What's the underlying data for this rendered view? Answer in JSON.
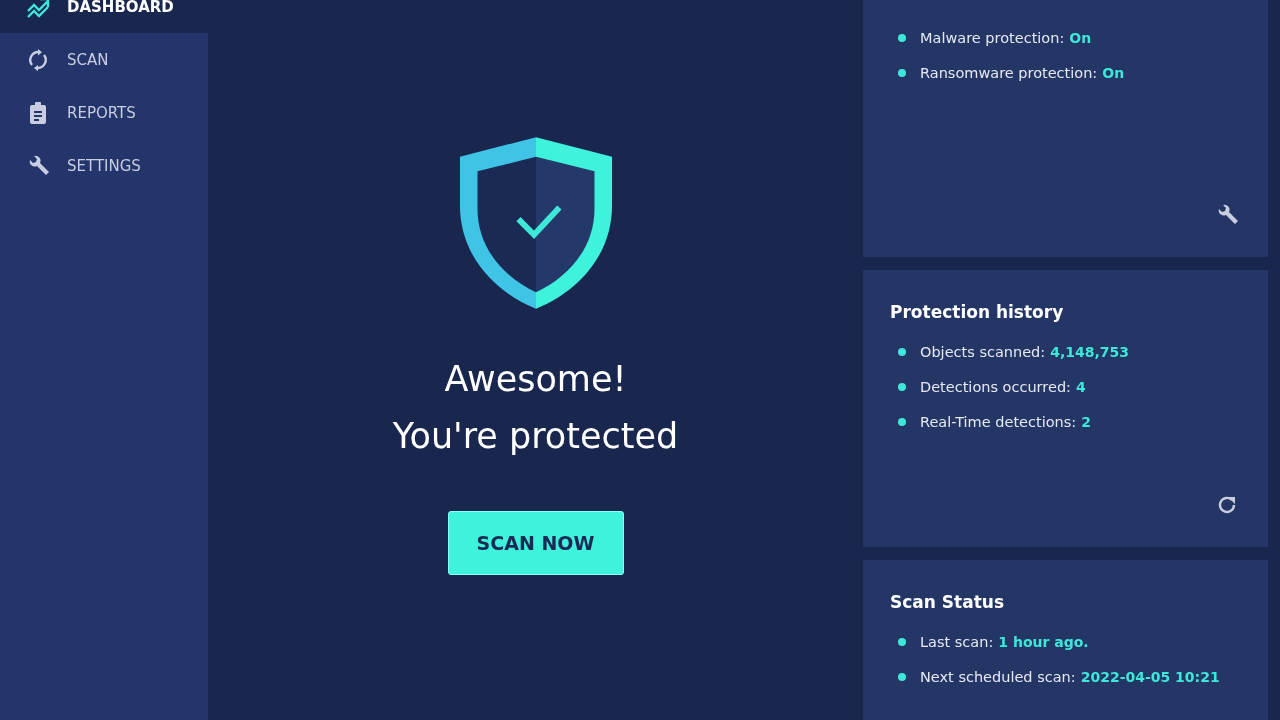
{
  "sidebar": {
    "items": [
      {
        "label": "DASHBOARD",
        "selected": true
      },
      {
        "label": "SCAN",
        "selected": false
      },
      {
        "label": "REPORTS",
        "selected": false
      },
      {
        "label": "SETTINGS",
        "selected": false
      }
    ]
  },
  "status": {
    "headline": "Awesome!",
    "subline": "You're protected",
    "button": "SCAN NOW"
  },
  "cards": [
    {
      "items": [
        {
          "label": "Malware protection:",
          "value": "On"
        },
        {
          "label": "Ransomware protection:",
          "value": "On"
        }
      ]
    },
    {
      "title": "Protection history",
      "items": [
        {
          "label": "Objects scanned:",
          "value": "4,148,753"
        },
        {
          "label": "Detections occurred:",
          "value": "4"
        },
        {
          "label": "Real-Time detections:",
          "value": "2"
        }
      ]
    },
    {
      "title": "Scan Status",
      "items": [
        {
          "label": "Last scan:",
          "value": "1 hour ago."
        },
        {
          "label": "Next scheduled scan:",
          "value": "2022-04-05 10:21"
        }
      ]
    }
  ]
}
